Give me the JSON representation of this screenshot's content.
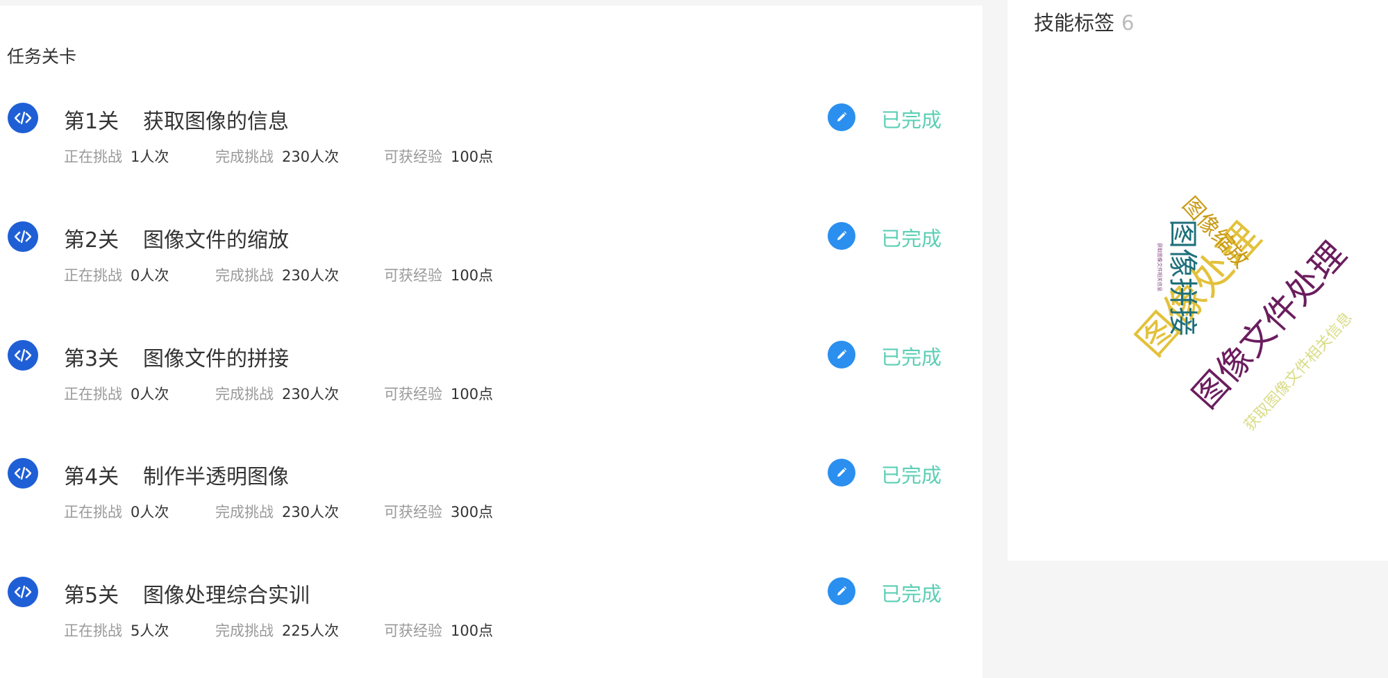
{
  "tasks": {
    "title": "任务关卡",
    "labels": {
      "in_progress": "正在挑战",
      "completed": "完成挑战",
      "experience": "可获经验"
    },
    "levels": [
      {
        "number": "第1关",
        "name": "获取图像的信息",
        "in_progress": "1人次",
        "completed": "230人次",
        "experience": "100点",
        "status": "已完成"
      },
      {
        "number": "第2关",
        "name": "图像文件的缩放",
        "in_progress": "0人次",
        "completed": "230人次",
        "experience": "100点",
        "status": "已完成"
      },
      {
        "number": "第3关",
        "name": "图像文件的拼接",
        "in_progress": "0人次",
        "completed": "230人次",
        "experience": "100点",
        "status": "已完成"
      },
      {
        "number": "第4关",
        "name": "制作半透明图像",
        "in_progress": "0人次",
        "completed": "230人次",
        "experience": "300点",
        "status": "已完成"
      },
      {
        "number": "第5关",
        "name": "图像处理综合实训",
        "in_progress": "5人次",
        "completed": "225人次",
        "experience": "100点",
        "status": "已完成"
      }
    ]
  },
  "skills": {
    "title": "技能标签",
    "count": "6",
    "tags": [
      {
        "text": "图像处理",
        "color": "#e3c13a"
      },
      {
        "text": "图像文件处理",
        "color": "#6a1d5e"
      },
      {
        "text": "图像拼接",
        "color": "#1e6f7a"
      },
      {
        "text": "图像缩放",
        "color": "#c99a14"
      },
      {
        "text": "获取图像文件相关信息",
        "color": "#dde08a"
      },
      {
        "text": "获取图像文件相关信息",
        "color": "#7d3f80"
      }
    ]
  },
  "icons": {
    "level": "code-icon",
    "action": "edit-pencil-icon"
  },
  "colors": {
    "code_icon": "#1f5fd6",
    "edit_icon": "#2a8fef",
    "status_done": "#5ccfb5"
  }
}
